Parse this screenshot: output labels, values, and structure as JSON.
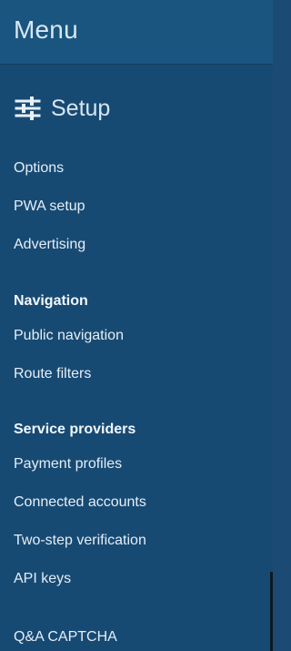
{
  "header": {
    "title": "Menu"
  },
  "section": {
    "label": "Setup",
    "icon": "sliders-icon"
  },
  "setup_items": [
    {
      "label": "Options"
    },
    {
      "label": "PWA setup"
    },
    {
      "label": "Advertising"
    }
  ],
  "navigation": {
    "title": "Navigation",
    "items": [
      {
        "label": "Public navigation"
      },
      {
        "label": "Route filters"
      }
    ]
  },
  "service_providers": {
    "title": "Service providers",
    "items": [
      {
        "label": "Payment profiles"
      },
      {
        "label": "Connected accounts"
      },
      {
        "label": "Two-step verification"
      },
      {
        "label": "API keys"
      }
    ]
  },
  "footer_item": {
    "label": "Q&A CAPTCHA"
  },
  "colors": {
    "background": "#174a73",
    "header_background": "#1a5580",
    "text": "#e5eef6"
  }
}
